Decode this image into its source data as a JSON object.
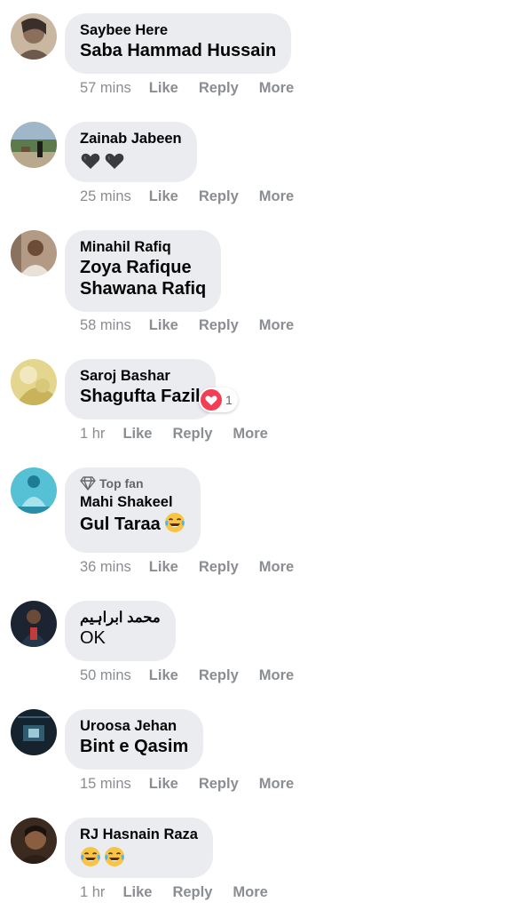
{
  "comments": [
    {
      "author": "Saybee Here",
      "text": "Saba Hammad Hussain",
      "time": "57 mins"
    },
    {
      "author": "Zainab Jabeen",
      "emojis": [
        "black-heart-emoji",
        "black-heart-emoji"
      ],
      "time": "25 mins"
    },
    {
      "author": "Minahil Rafiq",
      "text_lines": [
        "Zoya Rafique",
        "Shawana Rafiq"
      ],
      "time": "58 mins"
    },
    {
      "author": "Saroj Bashar",
      "text": "Shagufta Fazil",
      "reaction": {
        "icon": "heart-reaction-icon",
        "count": "1"
      },
      "time": "1 hr"
    },
    {
      "badge": "Top fan",
      "author": "Mahi Shakeel",
      "text": "Gul Taraa",
      "emoji": "tears-of-joy-emoji",
      "time": "36 mins"
    },
    {
      "author": "محمد ابراہیم",
      "text": "OK",
      "time": "50 mins"
    },
    {
      "author": "Uroosa Jehan",
      "text": "Bint e Qasim",
      "time": "15 mins"
    },
    {
      "author": "RJ Hasnain Raza",
      "emojis": [
        "tears-of-joy-emoji",
        "tears-of-joy-emoji"
      ],
      "time": "1 hr"
    }
  ],
  "actions": {
    "like": "Like",
    "reply": "Reply",
    "more": "More"
  },
  "colors": {
    "bubble": "#ebecf0",
    "meta": "#8a8d91",
    "heart": "#f33e58"
  }
}
